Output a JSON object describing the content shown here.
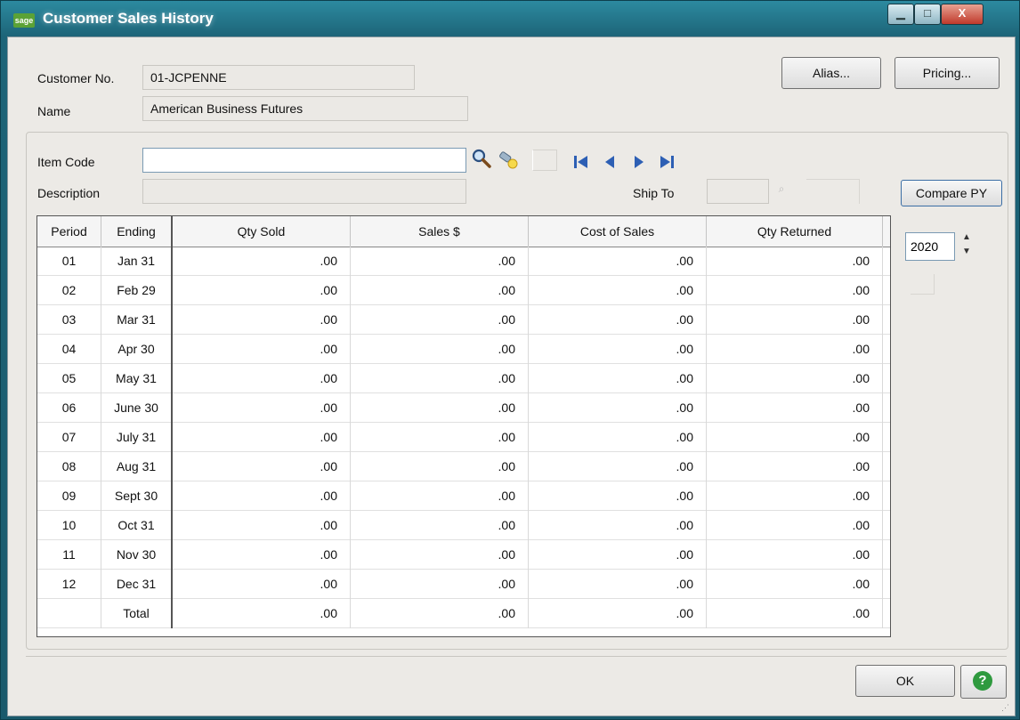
{
  "window": {
    "logo_text": "sage",
    "title": "Customer Sales History",
    "minimize": "▁",
    "maximize": "□",
    "close": "X"
  },
  "customer": {
    "no_label": "Customer No.",
    "no_value": "01-JCPENNE",
    "name_label": "Name",
    "name_value": "American Business Futures"
  },
  "buttons": {
    "alias": "Alias...",
    "pricing": "Pricing...",
    "compare_py": "Compare PY",
    "ok": "OK",
    "help": "?"
  },
  "item": {
    "code_label": "Item Code",
    "code_value": "",
    "description_label": "Description",
    "description_value": "",
    "ship_to_label": "Ship To"
  },
  "year": {
    "value": "2020"
  },
  "table": {
    "headers": [
      "Period",
      "Ending",
      "Qty Sold",
      "Sales $",
      "Cost of Sales",
      "Qty Returned"
    ],
    "rows": [
      [
        "01",
        "Jan 31",
        ".00",
        ".00",
        ".00",
        ".00"
      ],
      [
        "02",
        "Feb 29",
        ".00",
        ".00",
        ".00",
        ".00"
      ],
      [
        "03",
        "Mar 31",
        ".00",
        ".00",
        ".00",
        ".00"
      ],
      [
        "04",
        "Apr 30",
        ".00",
        ".00",
        ".00",
        ".00"
      ],
      [
        "05",
        "May 31",
        ".00",
        ".00",
        ".00",
        ".00"
      ],
      [
        "06",
        "June 30",
        ".00",
        ".00",
        ".00",
        ".00"
      ],
      [
        "07",
        "July 31",
        ".00",
        ".00",
        ".00",
        ".00"
      ],
      [
        "08",
        "Aug 31",
        ".00",
        ".00",
        ".00",
        ".00"
      ],
      [
        "09",
        "Sept 30",
        ".00",
        ".00",
        ".00",
        ".00"
      ],
      [
        "10",
        "Oct 31",
        ".00",
        ".00",
        ".00",
        ".00"
      ],
      [
        "11",
        "Nov 30",
        ".00",
        ".00",
        ".00",
        ".00"
      ],
      [
        "12",
        "Dec 31",
        ".00",
        ".00",
        ".00",
        ".00"
      ],
      [
        "",
        "Total",
        ".00",
        ".00",
        ".00",
        ".00"
      ]
    ]
  },
  "colors": {
    "titlebar": "#1d6478",
    "accent_green": "#2f9a3f",
    "nav_blue": "#2d5fb4"
  }
}
